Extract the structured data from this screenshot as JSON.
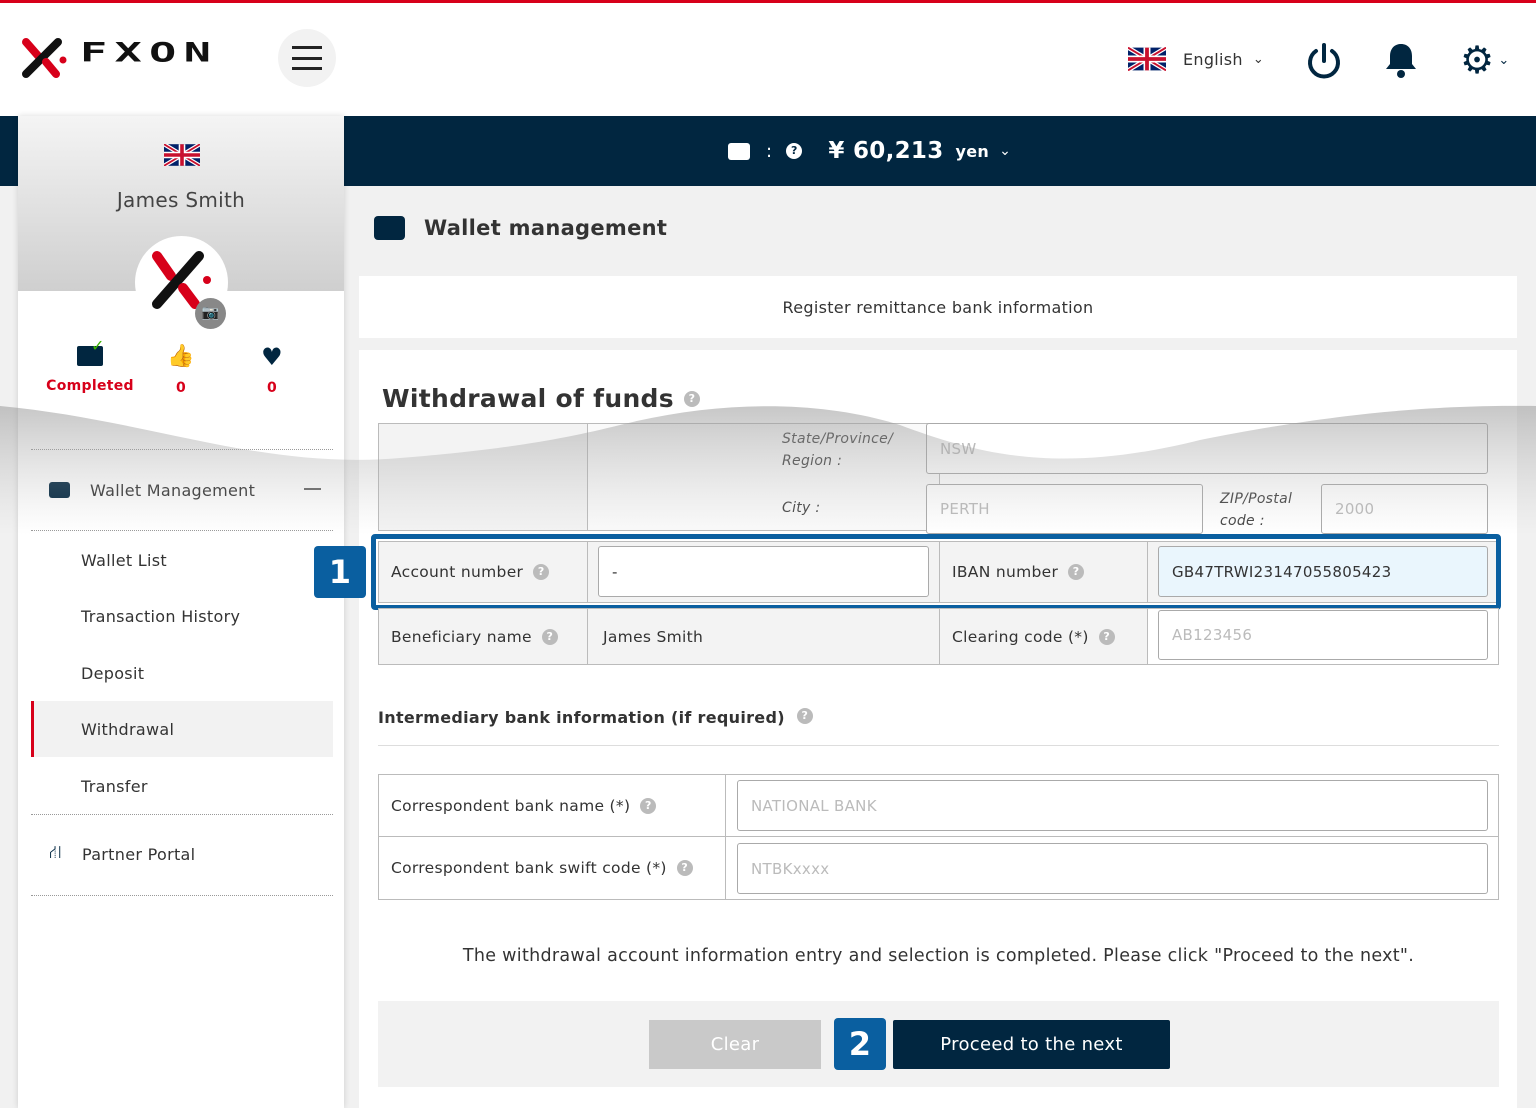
{
  "header": {
    "brand": "FXON",
    "language": "English",
    "icons": [
      "menu-icon",
      "uk-flag-icon",
      "power-icon",
      "bell-icon",
      "gear-icon"
    ]
  },
  "balance": {
    "separator": ":",
    "amount": "¥ 60,213",
    "unit": "yen"
  },
  "profile": {
    "name": "James Smith",
    "status": "Completed",
    "likes": "0",
    "favorites": "0"
  },
  "sidebar": {
    "section": "Wallet Management",
    "items": [
      {
        "label": "Wallet List"
      },
      {
        "label": "Transaction History"
      },
      {
        "label": "Deposit"
      },
      {
        "label": "Withdrawal"
      },
      {
        "label": "Transfer"
      }
    ],
    "partner": "Partner Portal",
    "active": "Withdrawal"
  },
  "page": {
    "title": "Wallet management",
    "subtab": "Register remittance bank information",
    "section_title": "Withdrawal of funds"
  },
  "form": {
    "state_label": "State/Province/ Region :",
    "state_value": "NSW",
    "city_label": "City :",
    "city_value": "PERTH",
    "zip_label": "ZIP/Postal code :",
    "zip_value": "2000",
    "account_label": "Account number",
    "account_value": "-",
    "iban_label": "IBAN number",
    "iban_value": "GB47TRWI23147055805423",
    "beneficiary_label": "Beneficiary name",
    "beneficiary_value": "James Smith",
    "clearing_label": "Clearing code (*)",
    "clearing_placeholder": "AB123456"
  },
  "intermediary": {
    "title": "Intermediary bank information (if required)",
    "bank_name_label": "Correspondent bank name (*)",
    "bank_name_placeholder": "NATIONAL BANK",
    "swift_label": "Correspondent bank swift code (*)",
    "swift_placeholder": "NTBKxxxx"
  },
  "message": "The withdrawal account information entry and selection is completed. Please click \"Proceed to the next\".",
  "buttons": {
    "clear": "Clear",
    "proceed": "Proceed to the next"
  },
  "badges": {
    "one": "1",
    "two": "2"
  },
  "colors": {
    "accent": "#d7001a",
    "navy": "#012640",
    "highlight": "#0a5fa0"
  }
}
